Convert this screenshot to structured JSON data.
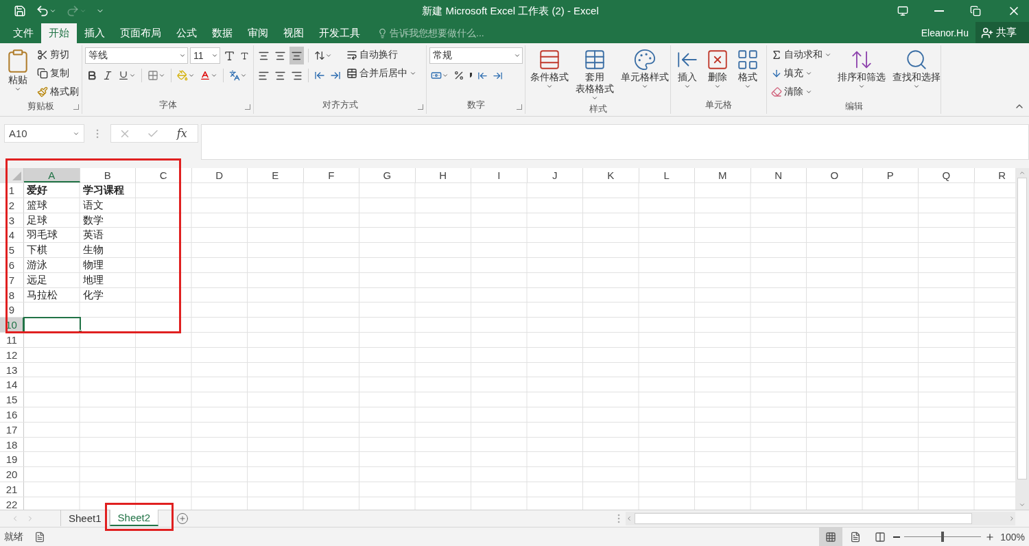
{
  "window": {
    "title": "新建 Microsoft Excel 工作表 (2) - Excel"
  },
  "menu": {
    "tabs": [
      {
        "label": "文件",
        "selected": false
      },
      {
        "label": "开始",
        "selected": true
      },
      {
        "label": "插入",
        "selected": false
      },
      {
        "label": "页面布局",
        "selected": false
      },
      {
        "label": "公式",
        "selected": false
      },
      {
        "label": "数据",
        "selected": false
      },
      {
        "label": "审阅",
        "selected": false
      },
      {
        "label": "视图",
        "selected": false
      },
      {
        "label": "开发工具",
        "selected": false
      }
    ],
    "tell_me": {
      "placeholder": "告诉我您想要做什么..."
    },
    "user": "Eleanor.Hu",
    "share": "共享"
  },
  "ribbon": {
    "groups": [
      {
        "kind": "clipboard",
        "label": "剪贴板",
        "paste": "粘贴",
        "items": [
          "剪切",
          "复制",
          "格式刷"
        ]
      },
      {
        "kind": "font",
        "label": "字体",
        "font": "等线",
        "size": "11"
      },
      {
        "kind": "alignment",
        "label": "对齐方式",
        "wrap": "自动换行",
        "merge": "合并后居中"
      },
      {
        "kind": "number",
        "label": "数字",
        "format": "常规"
      },
      {
        "kind": "large",
        "label": "样式",
        "buttons": [
          {
            "lines": [
              "条件格式"
            ]
          },
          {
            "lines": [
              "套用",
              "表格格式"
            ]
          },
          {
            "lines": [
              "单元格样式"
            ]
          }
        ]
      },
      {
        "kind": "large",
        "label": "单元格",
        "buttons": [
          {
            "lines": [
              "插入"
            ]
          },
          {
            "lines": [
              "删除"
            ]
          },
          {
            "lines": [
              "格式"
            ]
          }
        ]
      },
      {
        "kind": "editing",
        "label": "编辑",
        "items": [
          "自动求和",
          "填充",
          "清除"
        ],
        "buttons": [
          {
            "lines": [
              "排序和筛选"
            ]
          },
          {
            "lines": [
              "查找和选择"
            ]
          }
        ]
      }
    ]
  },
  "formula_bar": {
    "name_box": "A10",
    "function_label": "fx"
  },
  "sheet": {
    "columns": [
      {
        "label": "A",
        "selected": true
      },
      {
        "label": "B",
        "selected": false
      },
      {
        "label": "C",
        "selected": false
      },
      {
        "label": "D",
        "selected": false
      },
      {
        "label": "E",
        "selected": false
      },
      {
        "label": "F",
        "selected": false
      },
      {
        "label": "G",
        "selected": false
      },
      {
        "label": "H",
        "selected": false
      },
      {
        "label": "I",
        "selected": false
      },
      {
        "label": "J",
        "selected": false
      },
      {
        "label": "K",
        "selected": false
      },
      {
        "label": "L",
        "selected": false
      },
      {
        "label": "M",
        "selected": false
      },
      {
        "label": "N",
        "selected": false
      },
      {
        "label": "O",
        "selected": false
      },
      {
        "label": "P",
        "selected": false
      },
      {
        "label": "Q",
        "selected": false
      },
      {
        "label": "R",
        "selected": false
      }
    ],
    "rows": [
      {
        "label": "1",
        "selected": false,
        "bold": true,
        "cells": [
          "爱好",
          "学习课程"
        ]
      },
      {
        "label": "2",
        "selected": false,
        "bold": false,
        "cells": [
          "篮球",
          "语文"
        ]
      },
      {
        "label": "3",
        "selected": false,
        "bold": false,
        "cells": [
          "足球",
          "数学"
        ]
      },
      {
        "label": "4",
        "selected": false,
        "bold": false,
        "cells": [
          "羽毛球",
          "英语"
        ]
      },
      {
        "label": "5",
        "selected": false,
        "bold": false,
        "cells": [
          "下棋",
          "生物"
        ]
      },
      {
        "label": "6",
        "selected": false,
        "bold": false,
        "cells": [
          "游泳",
          "物理"
        ]
      },
      {
        "label": "7",
        "selected": false,
        "bold": false,
        "cells": [
          "远足",
          "地理"
        ]
      },
      {
        "label": "8",
        "selected": false,
        "bold": false,
        "cells": [
          "马拉松",
          "化学"
        ]
      },
      {
        "label": "9",
        "selected": false
      },
      {
        "label": "10",
        "selected": true
      },
      {
        "label": "11",
        "selected": false
      },
      {
        "label": "12",
        "selected": false
      },
      {
        "label": "13",
        "selected": false
      },
      {
        "label": "14",
        "selected": false
      },
      {
        "label": "15",
        "selected": false
      },
      {
        "label": "16",
        "selected": false
      },
      {
        "label": "17",
        "selected": false
      },
      {
        "label": "18",
        "selected": false
      },
      {
        "label": "19",
        "selected": false
      },
      {
        "label": "20",
        "selected": false
      },
      {
        "label": "21",
        "selected": false
      },
      {
        "label": "22",
        "selected": false
      }
    ]
  },
  "sheet_tabs": [
    {
      "label": "Sheet1",
      "selected": false
    },
    {
      "label": "Sheet2",
      "selected": true
    }
  ],
  "status_bar": {
    "status": "就绪",
    "views": [
      {
        "selected": true
      },
      {
        "selected": false
      },
      {
        "selected": false
      }
    ],
    "zoom": {
      "level": 0.5,
      "reading": "100%"
    }
  }
}
